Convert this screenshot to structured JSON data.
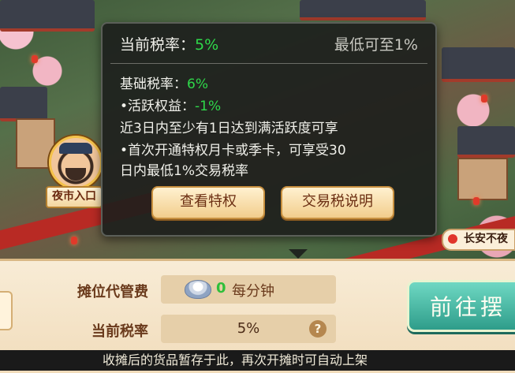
{
  "tooltip": {
    "current_rate_label": "当前税率：",
    "current_rate_value": "5%",
    "min_rate_note": "最低可至1%",
    "base_rate_label": "基础税率：",
    "base_rate_value": "6%",
    "active_benefit_label": "•活跃权益：",
    "active_benefit_value": "-1%",
    "active_condition": "近3日内至少有1日达到满活跃度可享",
    "privilege_line1": "•首次开通特权月卡或季卡，可享受30",
    "privilege_line2": "日内最低1%交易税率",
    "view_privilege_button": "查看特权",
    "tax_explain_button": "交易税说明"
  },
  "map": {
    "night_market_label": "夜市入口",
    "changan_label": "长安不夜"
  },
  "panel": {
    "stall_fee_label": "摊位代管费",
    "stall_fee_amount": "0",
    "stall_fee_unit": "每分钟",
    "current_rate_label": "当前税率",
    "current_rate_value": "5%",
    "help_icon_text": "?",
    "go_button_label": "前往摆"
  },
  "footer": {
    "notice": "收摊后的货品暂存于此，再次开摊时可自动上架"
  },
  "colors": {
    "green_value": "#2fd84a",
    "gold_button": "#f2cd8c",
    "teal_button": "#2e9d8a"
  }
}
